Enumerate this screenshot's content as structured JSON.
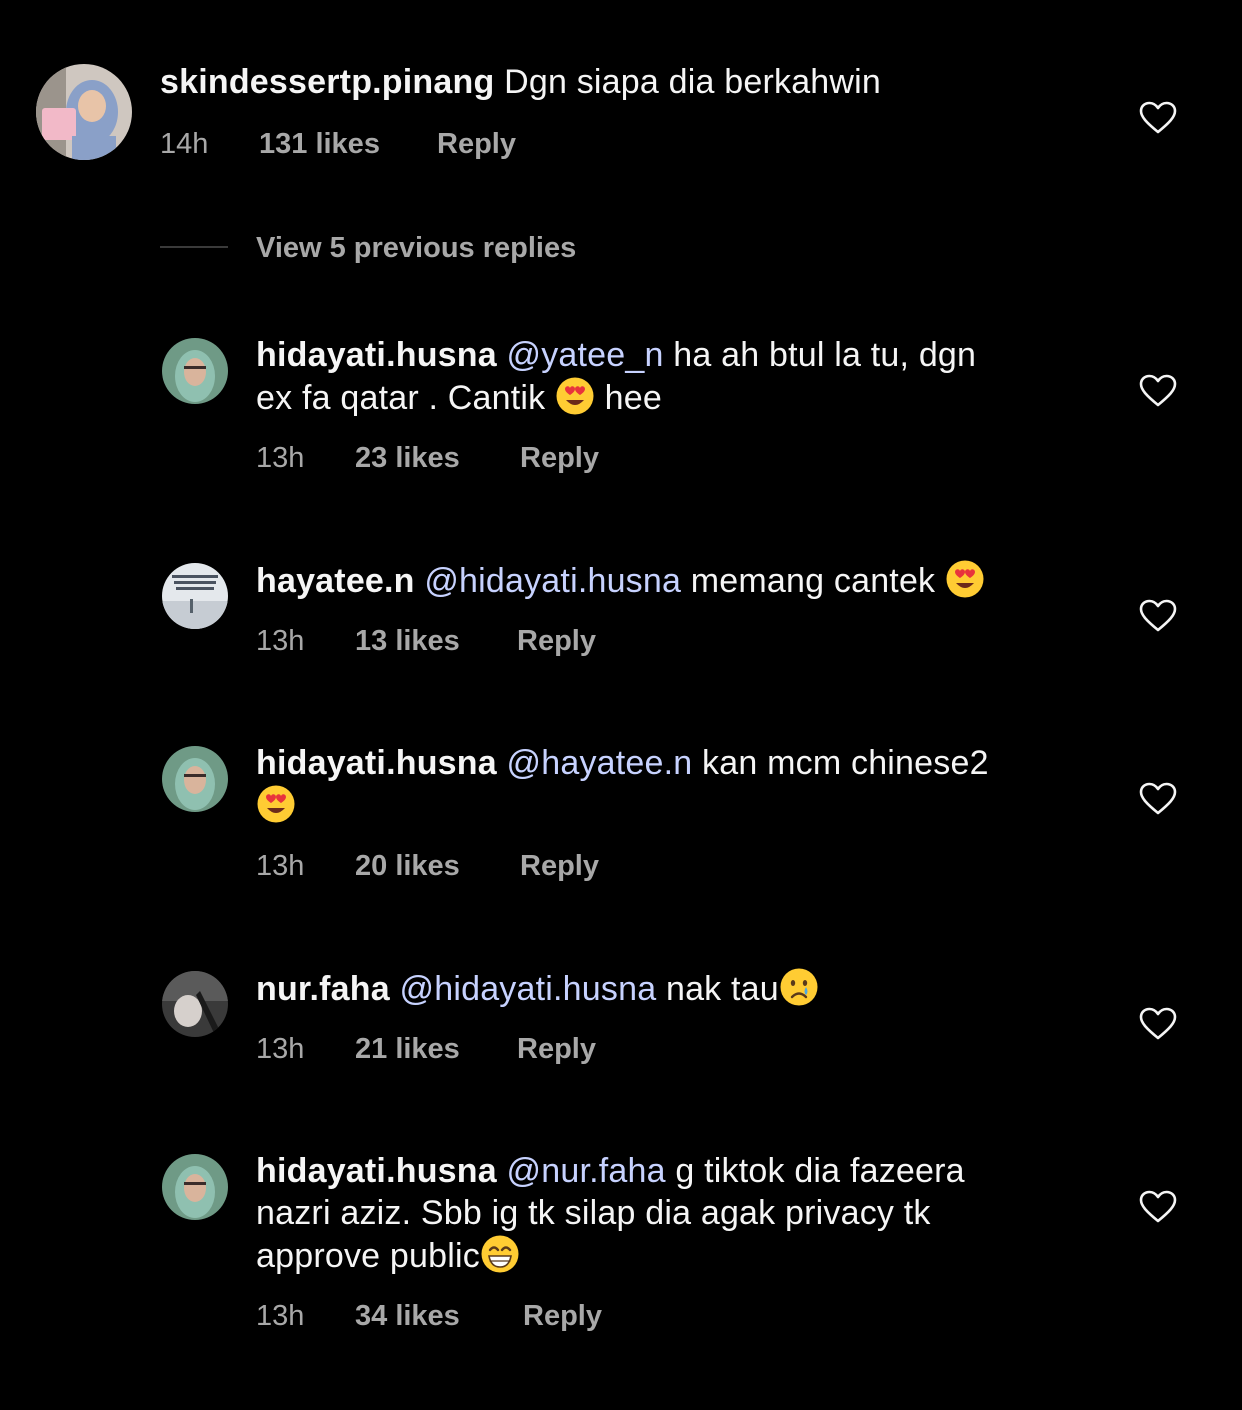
{
  "colors": {
    "background": "#000000",
    "text": "#f5f5f5",
    "secondary": "#a8a8a8",
    "mention": "#c7d2ff"
  },
  "parent_comment": {
    "username": "skindessertp.pinang",
    "text": "Dgn siapa dia berkahwin",
    "time": "14h",
    "likes": "131 likes",
    "reply": "Reply",
    "avatar_icon": "profile-photo",
    "like_icon": "heart-outline-icon"
  },
  "view_replies": {
    "label": "View 5 previous replies"
  },
  "replies": [
    {
      "username": "hidayati.husna",
      "mention": "@yatee_n",
      "text_line1": " ha ah btul la tu, dgn",
      "text_line2a": "ex fa qatar . Cantik ",
      "text_line2b": " hee",
      "time": "13h",
      "likes": "23 likes",
      "reply": "Reply",
      "emoji": "heart-eyes-emoji"
    },
    {
      "username": "hayatee.n",
      "mention": "@hidayati.husna",
      "text_line1": " memang cantek ",
      "time": "13h",
      "likes": "13 likes",
      "reply": "Reply",
      "emoji": "heart-eyes-emoji"
    },
    {
      "username": "hidayati.husna",
      "mention": "@hayatee.n",
      "text_line1": " kan mcm chinese2",
      "time": "13h",
      "likes": "20 likes",
      "reply": "Reply",
      "emoji": "heart-eyes-emoji"
    },
    {
      "username": "nur.faha",
      "mention": "@hidayati.husna",
      "text_line1": " nak tau",
      "time": "13h",
      "likes": "21 likes",
      "reply": "Reply",
      "emoji": "crying-face-emoji"
    },
    {
      "username": "hidayati.husna",
      "mention": "@nur.faha",
      "text_line1": " g tiktok dia fazeera",
      "text_line2": "nazri aziz. Sbb ig tk silap dia agak privacy tk",
      "text_line3": "approve public",
      "time": "13h",
      "likes": "34 likes",
      "reply": "Reply",
      "emoji": "grinning-face-emoji"
    }
  ]
}
